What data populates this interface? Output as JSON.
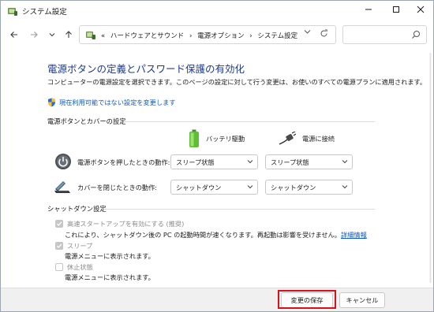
{
  "window": {
    "title": "システム設定"
  },
  "address": {
    "prefix": "«",
    "crumbs": [
      "ハードウェアとサウンド",
      "電源オプション",
      "システム設定"
    ],
    "separator": "›"
  },
  "page": {
    "title": "電源ボタンの定義とパスワード保護の有効化",
    "description": "コンピューターの電源設定を選択できます。このページの設定に対して行う変更は、お使いのすべての電源プランに適用されます。",
    "link": "現在利用可能ではない設定を変更します"
  },
  "power_section": {
    "label": "電源ボタンとカバーの設定",
    "col_battery": "バッテリ駆動",
    "col_plugged": "電源に接続",
    "rows": [
      {
        "label": "電源ボタンを押したときの動作:",
        "battery": "スリープ状態",
        "plugged": "スリープ状態"
      },
      {
        "label": "カバーを閉じたときの動作:",
        "battery": "シャットダウン",
        "plugged": "シャットダウン"
      }
    ]
  },
  "shutdown_section": {
    "label": "シャットダウン設定",
    "items": [
      {
        "label": "高速スタートアップを有効にする (推奨)",
        "checked": true,
        "desc": "これにより、シャットダウン後の PC の起動時間が速くなります。再起動は影響を受けません。",
        "link": "詳細情報"
      },
      {
        "label": "スリープ",
        "checked": true,
        "desc": "電源メニューに表示されます。"
      },
      {
        "label": "休止状態",
        "checked": false,
        "desc": "電源メニューに表示されます。"
      }
    ]
  },
  "footer": {
    "save": "変更の保存",
    "cancel": "キャンセル"
  },
  "colors": {
    "title": "#1e3b8a",
    "link": "#0a59c4",
    "highlight": "#d9101e"
  }
}
